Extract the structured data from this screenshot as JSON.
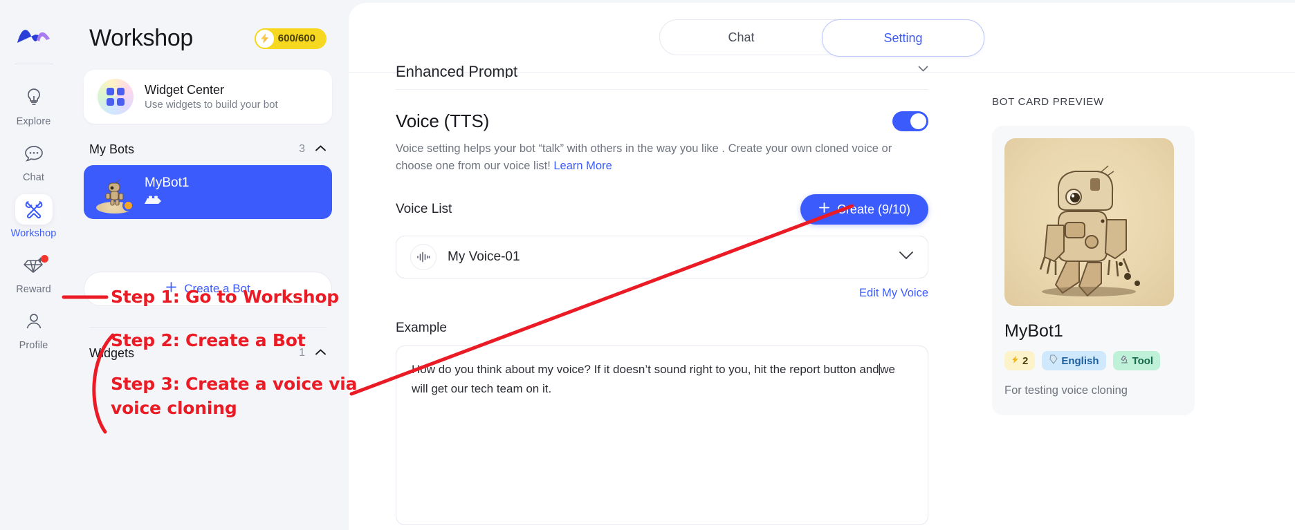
{
  "rail": {
    "logo_icon": "brand-wave-logo",
    "items": [
      {
        "label": "Explore",
        "icon": "lightbulb-icon",
        "active": false,
        "badge": false
      },
      {
        "label": "Chat",
        "icon": "chat-bubble-icon",
        "active": false,
        "badge": false
      },
      {
        "label": "Workshop",
        "icon": "tools-icon",
        "active": true,
        "badge": false
      },
      {
        "label": "Reward",
        "icon": "diamond-icon",
        "active": false,
        "badge": true
      },
      {
        "label": "Profile",
        "icon": "person-icon",
        "active": false,
        "badge": false
      }
    ]
  },
  "panel": {
    "title": "Workshop",
    "credits": "600/600",
    "credits_icon": "lightning-bolt-icon",
    "widget_card": {
      "name": "Widget Center",
      "subtitle": "Use widgets to build your bot",
      "icon": "widget-grid-icon"
    },
    "my_bots": {
      "title": "My Bots",
      "count": "3",
      "chevron": "chevron-up-icon",
      "bots": [
        {
          "name": "MyBot1",
          "selected": true,
          "status": "online",
          "chip_icon": "brick-icon"
        }
      ]
    },
    "create_bot_label": "Create a Bot",
    "create_bot_icon": "plus-icon",
    "widgets": {
      "title": "Widgets",
      "count": "1",
      "chevron": "chevron-up-icon"
    }
  },
  "main": {
    "tabs": [
      {
        "label": "Chat",
        "active": false
      },
      {
        "label": "Setting",
        "active": true
      }
    ],
    "collapsed_section": {
      "label": "Enhanced Prompt",
      "chevron": "chevron-down-icon"
    },
    "voice": {
      "title": "Voice (TTS)",
      "enabled": true,
      "description": "Voice setting helps your bot “talk” with others in the way you like . Create your own cloned voice or choose one from our voice list!",
      "learn_more": "Learn More",
      "voice_list_label": "Voice List",
      "create_button": "Create (9/10)",
      "create_button_icon": "plus-icon",
      "selected_voice": "My Voice-01",
      "voice_icon": "waveform-icon",
      "dropdown_icon": "chevron-down-icon",
      "edit_link": "Edit My Voice",
      "example_label": "Example",
      "example_text_before_caret": "How do you think about my voice?  If it doesn’t sound right to you, hit the report button and",
      "example_text_after_caret": "we will get our tech team on it."
    },
    "preview": {
      "label": "BOT CARD PREVIEW",
      "bot_name": "MyBot1",
      "chips": [
        {
          "icon": "lightning-bolt-icon",
          "label": "2",
          "kind": "credits"
        },
        {
          "icon": "tag-icon",
          "label": "English",
          "kind": "lang"
        },
        {
          "icon": "microscope-icon",
          "label": "Tool",
          "kind": "tool"
        }
      ],
      "description": "For testing voice cloning",
      "avatar_icon": "robot-illustration"
    }
  },
  "annotations": {
    "step1": "Step 1: Go to Workshop",
    "step2": "Step 2: Create a Bot",
    "step3_line1": "Step 3: Create a voice via",
    "step3_line2": "voice cloning",
    "color": "#ea1b24"
  }
}
